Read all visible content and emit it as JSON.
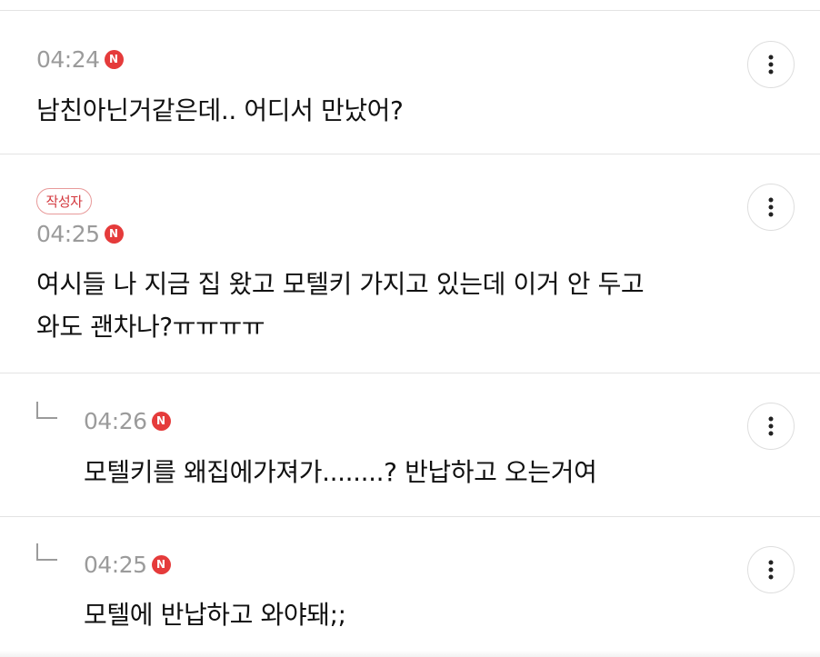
{
  "comments": [
    {
      "time": "04:24",
      "new_badge": "N",
      "is_reply": false,
      "lines": [
        "남친아닌거같은데.. 어디서 만났어?"
      ]
    },
    {
      "author_badge": "작성자",
      "time": "04:25",
      "new_badge": "N",
      "is_reply": false,
      "lines": [
        "여시들 나 지금 집 왔고 모텔키 가지고 있는데 이거 안 두고",
        "와도 괜차나?ㅠㅠㅠㅠ"
      ]
    },
    {
      "time": "04:26",
      "new_badge": "N",
      "is_reply": true,
      "lines": [
        "모텔키를 왜집에가져가........? 반납하고 오는거여"
      ]
    },
    {
      "time": "04:25",
      "new_badge": "N",
      "is_reply": true,
      "lines": [
        "모텔에 반납하고 와야돼;;"
      ]
    }
  ],
  "colors": {
    "badge_red": "#e53b3b",
    "author_badge_text": "#d3373d",
    "time_gray": "#9b9b9b"
  },
  "icons": {
    "more": "more-vertical-icon",
    "reply": "reply-arrow-icon",
    "new": "new-badge-icon"
  }
}
